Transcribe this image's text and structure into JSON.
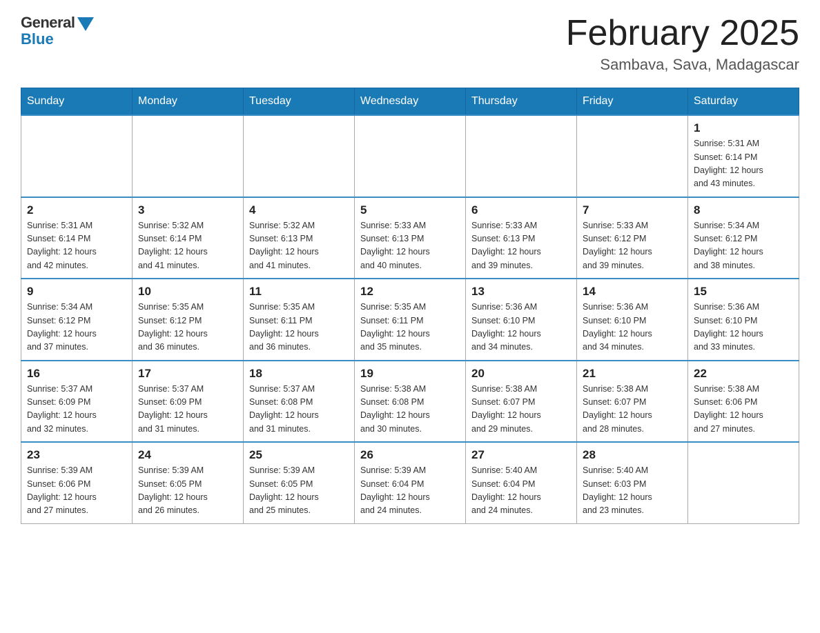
{
  "header": {
    "logo_general": "General",
    "logo_blue": "Blue",
    "month_title": "February 2025",
    "location": "Sambava, Sava, Madagascar"
  },
  "days_of_week": [
    "Sunday",
    "Monday",
    "Tuesday",
    "Wednesday",
    "Thursday",
    "Friday",
    "Saturday"
  ],
  "weeks": [
    [
      {
        "day": "",
        "info": ""
      },
      {
        "day": "",
        "info": ""
      },
      {
        "day": "",
        "info": ""
      },
      {
        "day": "",
        "info": ""
      },
      {
        "day": "",
        "info": ""
      },
      {
        "day": "",
        "info": ""
      },
      {
        "day": "1",
        "info": "Sunrise: 5:31 AM\nSunset: 6:14 PM\nDaylight: 12 hours\nand 43 minutes."
      }
    ],
    [
      {
        "day": "2",
        "info": "Sunrise: 5:31 AM\nSunset: 6:14 PM\nDaylight: 12 hours\nand 42 minutes."
      },
      {
        "day": "3",
        "info": "Sunrise: 5:32 AM\nSunset: 6:14 PM\nDaylight: 12 hours\nand 41 minutes."
      },
      {
        "day": "4",
        "info": "Sunrise: 5:32 AM\nSunset: 6:13 PM\nDaylight: 12 hours\nand 41 minutes."
      },
      {
        "day": "5",
        "info": "Sunrise: 5:33 AM\nSunset: 6:13 PM\nDaylight: 12 hours\nand 40 minutes."
      },
      {
        "day": "6",
        "info": "Sunrise: 5:33 AM\nSunset: 6:13 PM\nDaylight: 12 hours\nand 39 minutes."
      },
      {
        "day": "7",
        "info": "Sunrise: 5:33 AM\nSunset: 6:12 PM\nDaylight: 12 hours\nand 39 minutes."
      },
      {
        "day": "8",
        "info": "Sunrise: 5:34 AM\nSunset: 6:12 PM\nDaylight: 12 hours\nand 38 minutes."
      }
    ],
    [
      {
        "day": "9",
        "info": "Sunrise: 5:34 AM\nSunset: 6:12 PM\nDaylight: 12 hours\nand 37 minutes."
      },
      {
        "day": "10",
        "info": "Sunrise: 5:35 AM\nSunset: 6:12 PM\nDaylight: 12 hours\nand 36 minutes."
      },
      {
        "day": "11",
        "info": "Sunrise: 5:35 AM\nSunset: 6:11 PM\nDaylight: 12 hours\nand 36 minutes."
      },
      {
        "day": "12",
        "info": "Sunrise: 5:35 AM\nSunset: 6:11 PM\nDaylight: 12 hours\nand 35 minutes."
      },
      {
        "day": "13",
        "info": "Sunrise: 5:36 AM\nSunset: 6:10 PM\nDaylight: 12 hours\nand 34 minutes."
      },
      {
        "day": "14",
        "info": "Sunrise: 5:36 AM\nSunset: 6:10 PM\nDaylight: 12 hours\nand 34 minutes."
      },
      {
        "day": "15",
        "info": "Sunrise: 5:36 AM\nSunset: 6:10 PM\nDaylight: 12 hours\nand 33 minutes."
      }
    ],
    [
      {
        "day": "16",
        "info": "Sunrise: 5:37 AM\nSunset: 6:09 PM\nDaylight: 12 hours\nand 32 minutes."
      },
      {
        "day": "17",
        "info": "Sunrise: 5:37 AM\nSunset: 6:09 PM\nDaylight: 12 hours\nand 31 minutes."
      },
      {
        "day": "18",
        "info": "Sunrise: 5:37 AM\nSunset: 6:08 PM\nDaylight: 12 hours\nand 31 minutes."
      },
      {
        "day": "19",
        "info": "Sunrise: 5:38 AM\nSunset: 6:08 PM\nDaylight: 12 hours\nand 30 minutes."
      },
      {
        "day": "20",
        "info": "Sunrise: 5:38 AM\nSunset: 6:07 PM\nDaylight: 12 hours\nand 29 minutes."
      },
      {
        "day": "21",
        "info": "Sunrise: 5:38 AM\nSunset: 6:07 PM\nDaylight: 12 hours\nand 28 minutes."
      },
      {
        "day": "22",
        "info": "Sunrise: 5:38 AM\nSunset: 6:06 PM\nDaylight: 12 hours\nand 27 minutes."
      }
    ],
    [
      {
        "day": "23",
        "info": "Sunrise: 5:39 AM\nSunset: 6:06 PM\nDaylight: 12 hours\nand 27 minutes."
      },
      {
        "day": "24",
        "info": "Sunrise: 5:39 AM\nSunset: 6:05 PM\nDaylight: 12 hours\nand 26 minutes."
      },
      {
        "day": "25",
        "info": "Sunrise: 5:39 AM\nSunset: 6:05 PM\nDaylight: 12 hours\nand 25 minutes."
      },
      {
        "day": "26",
        "info": "Sunrise: 5:39 AM\nSunset: 6:04 PM\nDaylight: 12 hours\nand 24 minutes."
      },
      {
        "day": "27",
        "info": "Sunrise: 5:40 AM\nSunset: 6:04 PM\nDaylight: 12 hours\nand 24 minutes."
      },
      {
        "day": "28",
        "info": "Sunrise: 5:40 AM\nSunset: 6:03 PM\nDaylight: 12 hours\nand 23 minutes."
      },
      {
        "day": "",
        "info": ""
      }
    ]
  ]
}
